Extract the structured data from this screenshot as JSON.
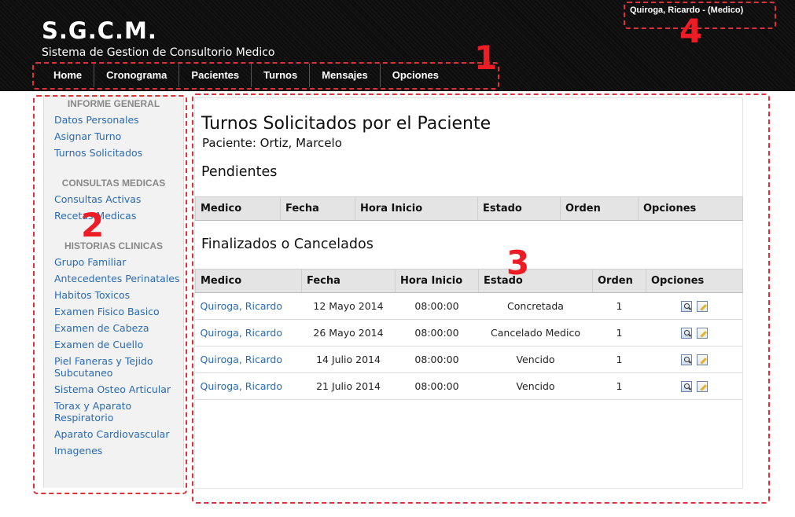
{
  "header": {
    "logo": "S.G.C.M.",
    "subtitle": "Sistema de Gestion de Consultorio Medico",
    "user": "Quiroga, Ricardo - (Medico)"
  },
  "nav": [
    "Home",
    "Cronograma",
    "Pacientes",
    "Turnos",
    "Mensajes",
    "Opciones"
  ],
  "annotations": [
    "1",
    "2",
    "3",
    "4"
  ],
  "sidebar": {
    "sections": [
      {
        "title": "INFORME GENERAL",
        "links": [
          "Datos Personales",
          "Asignar Turno",
          "Turnos Solicitados"
        ]
      },
      {
        "title": "CONSULTAS MEDICAS",
        "links": [
          "Consultas Activas",
          "Recetas Medicas"
        ]
      },
      {
        "title": "HISTORIAS CLINICAS",
        "links": [
          "Grupo Familiar",
          "Antecedentes Perinatales",
          "Habitos Toxicos",
          "Examen Fisico Basico",
          "Examen de Cabeza",
          "Examen de Cuello",
          "Piel Faneras y Tejido Subcutaneo",
          "Sistema Osteo Articular",
          "Torax y Aparato Respiratorio",
          "Aparato Cardiovascular",
          "Imagenes"
        ]
      }
    ]
  },
  "main": {
    "title": "Turnos Solicitados por el Paciente",
    "patient": "Paciente: Ortiz, Marcelo",
    "pending_title": "Pendientes",
    "pending_headers": [
      "Medico",
      "Fecha",
      "Hora Inicio",
      "Estado",
      "Orden",
      "Opciones"
    ],
    "finished_title": "Finalizados o Cancelados",
    "finished_headers": [
      "Medico",
      "Fecha",
      "Hora Inicio",
      "Estado",
      "Orden",
      "Opciones"
    ],
    "finished_rows": [
      [
        "Quiroga, Ricardo",
        "12 Mayo 2014",
        "08:00:00",
        "Concretada",
        "1"
      ],
      [
        "Quiroga, Ricardo",
        "26 Mayo 2014",
        "08:00:00",
        "Cancelado Medico",
        "1"
      ],
      [
        "Quiroga, Ricardo",
        "14 Julio 2014",
        "08:00:00",
        "Vencido",
        "1"
      ],
      [
        "Quiroga, Ricardo",
        "21 Julio 2014",
        "08:00:00",
        "Vencido",
        "1"
      ]
    ]
  },
  "icons": {
    "view": "view-icon",
    "edit": "edit-icon"
  },
  "colors": {
    "link": "#2a6ab0",
    "annotation": "#e0303a",
    "header_bg": "#0d0d0d"
  }
}
